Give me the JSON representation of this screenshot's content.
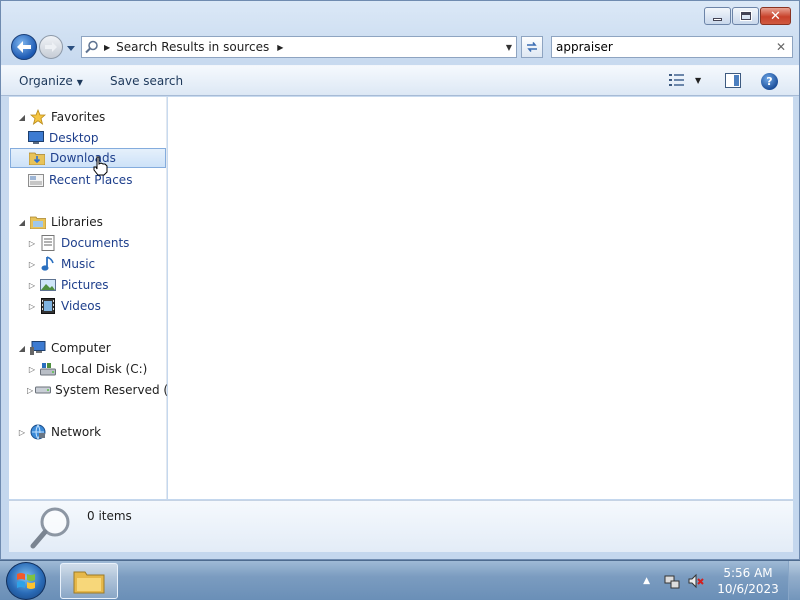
{
  "window": {
    "address": {
      "breadcrumb": "Search Results in sources"
    },
    "search": {
      "value": "appraiser"
    },
    "toolbar": {
      "organize_label": "Organize",
      "save_search_label": "Save search"
    },
    "nav": {
      "favorites": {
        "label": "Favorites",
        "items": [
          {
            "label": "Desktop",
            "icon": "desktop-icon"
          },
          {
            "label": "Downloads",
            "icon": "downloads-icon",
            "selected": true
          },
          {
            "label": "Recent Places",
            "icon": "recent-places-icon"
          }
        ]
      },
      "libraries": {
        "label": "Libraries",
        "items": [
          {
            "label": "Documents",
            "icon": "documents-icon"
          },
          {
            "label": "Music",
            "icon": "music-icon"
          },
          {
            "label": "Pictures",
            "icon": "pictures-icon"
          },
          {
            "label": "Videos",
            "icon": "videos-icon"
          }
        ]
      },
      "computer": {
        "label": "Computer",
        "items": [
          {
            "label": "Local Disk (C:)",
            "icon": "local-disk-icon"
          },
          {
            "label": "System Reserved (E:)",
            "icon": "drive-icon"
          }
        ]
      },
      "network": {
        "label": "Network"
      }
    },
    "details": {
      "count": "0 items"
    }
  },
  "taskbar": {
    "time": "5:56 AM",
    "date": "10/6/2023"
  },
  "colors": {
    "link_text": "#1e3f8c",
    "selection": "#cde2f8",
    "close_button": "#c8412b"
  }
}
